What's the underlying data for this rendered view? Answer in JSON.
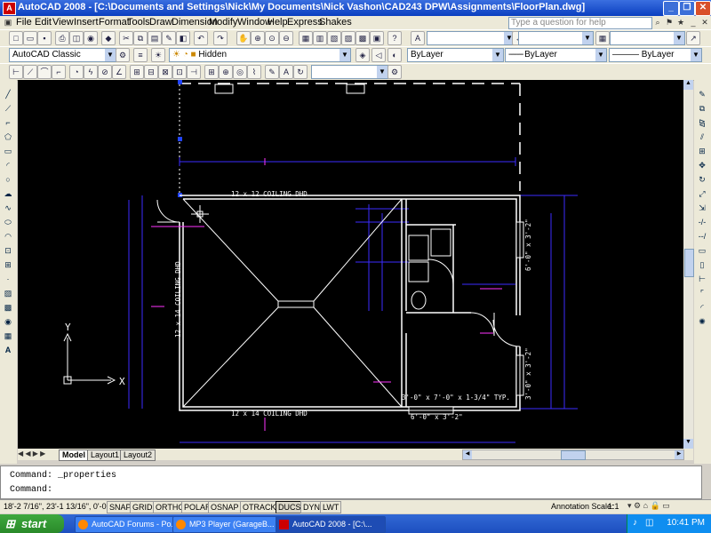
{
  "window": {
    "title": "AutoCAD 2008 - [C:\\Documents and Settings\\Nick\\My Documents\\Nick Vashon\\CAD243 DPW\\Assignments\\FloorPlan.dwg]"
  },
  "menu": {
    "items": [
      "File",
      "Edit",
      "View",
      "Insert",
      "Format",
      "Tools",
      "Draw",
      "Dimension",
      "Modify",
      "Window",
      "Help",
      "Express",
      "Shakes"
    ],
    "help_placeholder": "Type a question for help"
  },
  "toolbars": {
    "workspace": "AutoCAD Classic",
    "layer": "Hidden",
    "color": "ByLayer",
    "linetype": "ByLayer",
    "lineweight": "ByLayer"
  },
  "drawing": {
    "labels": {
      "ceiling_top": "12 x 12 COILING DHD",
      "ceiling_bottom": "12 x 14 COILING DHD",
      "ceiling_left": "12 x 14 COILING DHD",
      "door_note": "3'-0\" x 7'-0\" x 1-3/4\" TYP.",
      "window_bottom": "6'-0\" x 3'-2\"",
      "window_right_top": "6'-0\" x 3'-2\"",
      "window_right_bottom": "3'-0\" x 3'-2\""
    },
    "ucs": {
      "x": "X",
      "y": "Y"
    }
  },
  "layout_tabs": [
    "Model",
    "Layout1",
    "Layout2"
  ],
  "command": {
    "line1": "Command: _properties",
    "line2": "Command:"
  },
  "status": {
    "coords": "18'-2 7/16\", 23'-1 13/16\", 0'-0\"",
    "toggles": [
      {
        "label": "SNAP",
        "on": false
      },
      {
        "label": "GRID",
        "on": false
      },
      {
        "label": "ORTHO",
        "on": false
      },
      {
        "label": "POLAR",
        "on": false
      },
      {
        "label": "OSNAP",
        "on": false
      },
      {
        "label": "OTRACK",
        "on": false
      },
      {
        "label": "DUCS",
        "on": true
      },
      {
        "label": "DYN",
        "on": false
      },
      {
        "label": "LWT",
        "on": false
      }
    ],
    "annotation_scale_label": "Annotation Scale:",
    "annotation_scale": "1:1"
  },
  "taskbar": {
    "start": "start",
    "tasks": [
      {
        "label": "AutoCAD Forums - Po...",
        "active": false
      },
      {
        "label": "MP3 Player (GarageB...",
        "active": false
      },
      {
        "label": "AutoCAD 2008 - [C:\\...",
        "active": true
      }
    ],
    "clock": "10:41 PM"
  },
  "colors": {
    "canvas_bg": "#000000",
    "wall": "#ffffff",
    "dimension": "#3b2cff",
    "leader": "#ff33ff"
  }
}
